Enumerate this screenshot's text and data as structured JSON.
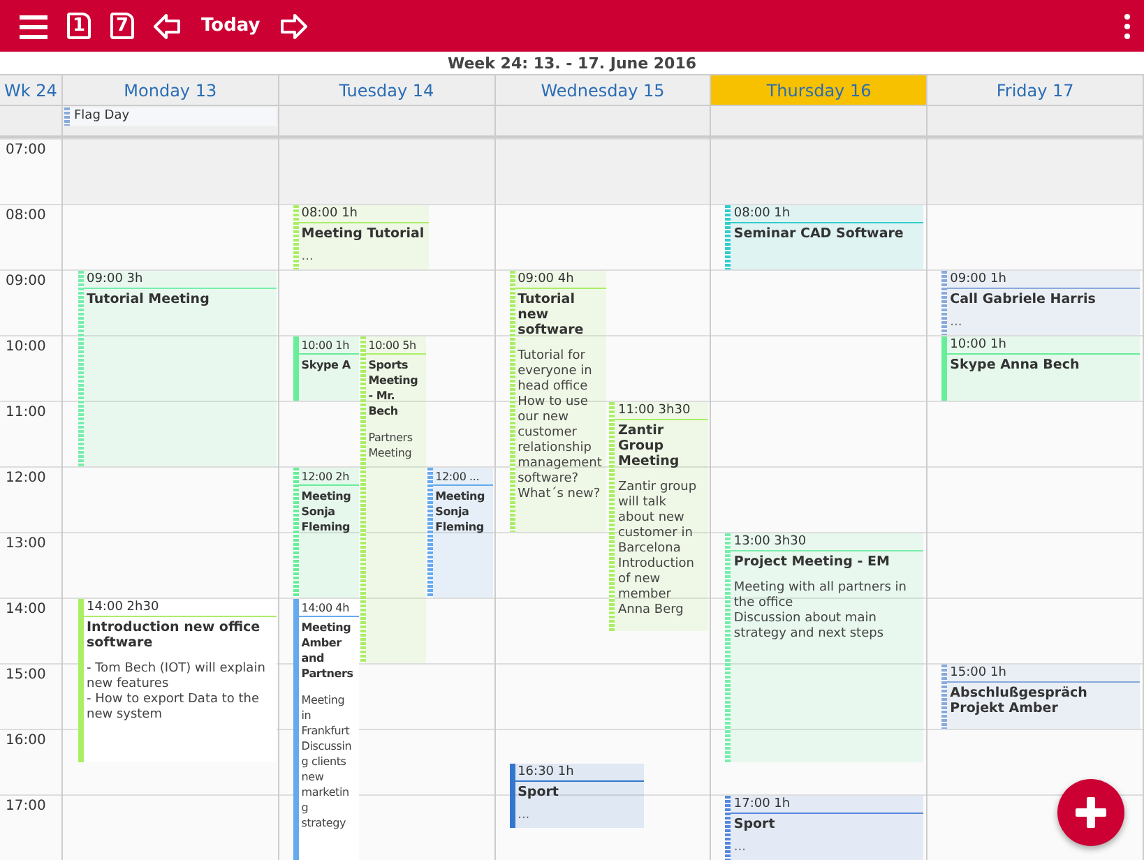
{
  "toolbar": {
    "day_view": "1",
    "week_view": "7",
    "today": "Today"
  },
  "week_title": "Week 24: 13. -  17. June  2016",
  "week_label": "Wk 24",
  "days": [
    {
      "name": "Monday  13",
      "today": false,
      "all_day": [
        {
          "title": "Flag Day",
          "color": "#88aadd"
        }
      ],
      "events": [
        {
          "time": "09:00 3h",
          "title": "Tutorial Meeting",
          "color": "#77eeaa",
          "tentative": true,
          "filled": true
        },
        {
          "time": "14:00 2h30",
          "title": "Introduction new office software",
          "lines": [
            "- Tom Bech (IOT) will explain new features",
            "- How to export Data to the new system"
          ],
          "color": "#aaee66",
          "tentative": false,
          "filled": false
        }
      ]
    },
    {
      "name": "Tuesday  14",
      "today": false,
      "events": [
        {
          "time": "08:00 1h",
          "title": "Meeting Tutorial",
          "more": "...",
          "color": "#aaee66",
          "tentative": true,
          "filled": true
        },
        {
          "time": "10:00 1h",
          "title": "Skype A",
          "color": "#66ee99",
          "tentative": false,
          "filled": true
        },
        {
          "time": "10:00 5h",
          "title": "Sports Meeting - Mr. Bech",
          "lines": [
            "Partners Meeting"
          ],
          "color": "#aaee66",
          "tentative": true,
          "filled": true
        },
        {
          "time": "12:00 2h",
          "title": "Meeting Sonja Fleming",
          "color": "#66ee99",
          "tentative": true,
          "filled": true
        },
        {
          "time": "12:00 ...",
          "title": "Meeting Sonja Fleming",
          "color": "#66aaee",
          "tentative": true,
          "filled": true
        },
        {
          "time": "14:00 4h",
          "title": "Meeting Amber and Partners",
          "lines": [
            "Meeting in Frankfurt",
            "Discussing clients new marketing strategy"
          ],
          "color": "#66aaee",
          "tentative": false,
          "filled": false
        }
      ]
    },
    {
      "name": "Wednesday  15",
      "today": false,
      "events": [
        {
          "time": "09:00 4h",
          "title": "Tutorial new software",
          "lines": [
            "Tutorial for everyone in head office",
            "How to use our new customer relationship management software? What´s new?"
          ],
          "color": "#aaee66",
          "tentative": true,
          "filled": true
        },
        {
          "time": "11:00 3h30",
          "title": "Zantir Group Meeting",
          "lines": [
            "Zantir group will talk about new customer in Barcelona",
            "Introduction of new member Anna Berg"
          ],
          "color": "#aaee66",
          "tentative": true,
          "filled": true
        },
        {
          "time": "16:30 1h",
          "title": "Sport",
          "more": "...",
          "color": "#3377cc",
          "tentative": false,
          "filled": true
        }
      ]
    },
    {
      "name": "Thursday  16",
      "today": true,
      "events": [
        {
          "time": "08:00 1h",
          "title": "Seminar CAD Software",
          "color": "#33cccc",
          "tentative": true,
          "filled": true
        },
        {
          "time": "13:00 3h30",
          "title": "Project Meeting - EM",
          "lines": [
            "Meeting with all partners in the office",
            "Discussion about main strategy and next steps"
          ],
          "color": "#77eeaa",
          "tentative": true,
          "filled": true
        },
        {
          "time": "17:00 1h",
          "title": "Sport",
          "more": "...",
          "color": "#5588dd",
          "tentative": true,
          "filled": true
        }
      ]
    },
    {
      "name": "Friday  17",
      "today": false,
      "events": [
        {
          "time": "09:00 1h",
          "title": "Call Gabriele Harris",
          "more": "...",
          "color": "#88aadd",
          "tentative": true,
          "filled": true
        },
        {
          "time": "10:00 1h",
          "title": "Skype Anna Bech",
          "color": "#66ee99",
          "tentative": false,
          "filled": true
        },
        {
          "time": "15:00 1h",
          "title": "Abschlußgespräch Projekt Amber",
          "color": "#88aadd",
          "tentative": true,
          "filled": true
        }
      ]
    }
  ],
  "hours": [
    "07:00",
    "08:00",
    "09:00",
    "10:00",
    "11:00",
    "12:00",
    "13:00",
    "14:00",
    "15:00",
    "16:00",
    "17:00"
  ]
}
